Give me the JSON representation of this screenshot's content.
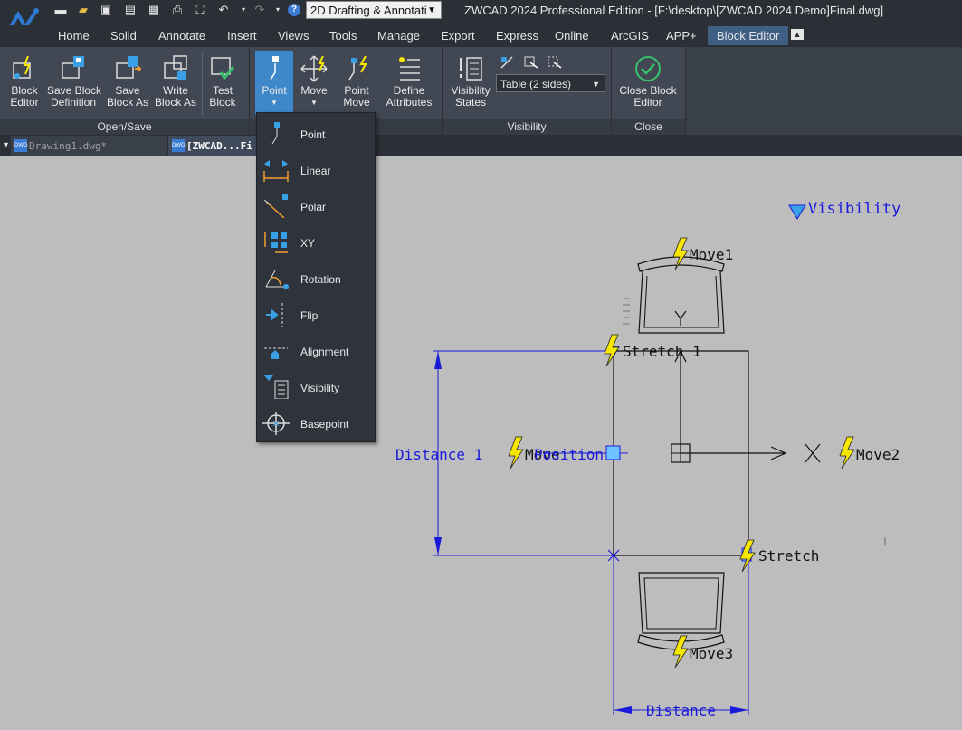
{
  "quick_access": {
    "workspace": "2D Drafting & Annotati",
    "icons": [
      "menu-icon",
      "open-folder-icon",
      "save-icon",
      "save-as-icon",
      "sheets-icon",
      "print-icon",
      "zoom-extents-icon",
      "undo-icon",
      "redo-icon",
      "help-icon"
    ]
  },
  "window": {
    "title": "ZWCAD 2024 Professional Edition - [F:\\desktop\\[ZWCAD 2024 Demo]Final.dwg]"
  },
  "menu_tabs": [
    "Home",
    "Solid",
    "Annotate",
    "Insert",
    "Views",
    "Tools",
    "Manage",
    "Export",
    "Express",
    "Online",
    "ArcGIS",
    "APP+",
    "Block Editor"
  ],
  "ribbon": {
    "open_save": {
      "label": "Open/Save",
      "buttons": [
        "Block\nEditor",
        "Save Block\nDefinition",
        "Save\nBlock As",
        "Write\nBlock As",
        "Test\nBlock"
      ]
    },
    "parameters": {
      "label": "Parameters",
      "buttons": [
        "Point",
        "Move",
        "Point\nMove",
        "Define\nAttributes"
      ]
    },
    "visibility": {
      "label": "Visibility",
      "states_button": "Visibility\nStates",
      "dropdown_value": "Table (2 sides)"
    },
    "close": {
      "label": "Close",
      "button": "Close Block\nEditor"
    }
  },
  "doc_tabs": [
    "Drawing1.dwg*",
    "[ZWCAD...Fi"
  ],
  "param_menu": {
    "items": [
      "Point",
      "Linear",
      "Polar",
      "XY",
      "Rotation",
      "Flip",
      "Alignment",
      "Visibility",
      "Basepoint"
    ]
  },
  "drawing": {
    "labels": {
      "visibility": "Visibility",
      "move1": "Move1",
      "move2": "Move2",
      "move3": "Move3",
      "stretch1": "Stretch 1",
      "stretch": "Stretch",
      "distance1": "Distance 1",
      "distance": "Distance",
      "position": "Position",
      "move_label": "Move",
      "y_axis": "Y",
      "x_axis": "X"
    }
  },
  "colors": {
    "accent": "#3f5f85",
    "param_blue": "#1a1adb",
    "lightning": "#f6e600"
  }
}
